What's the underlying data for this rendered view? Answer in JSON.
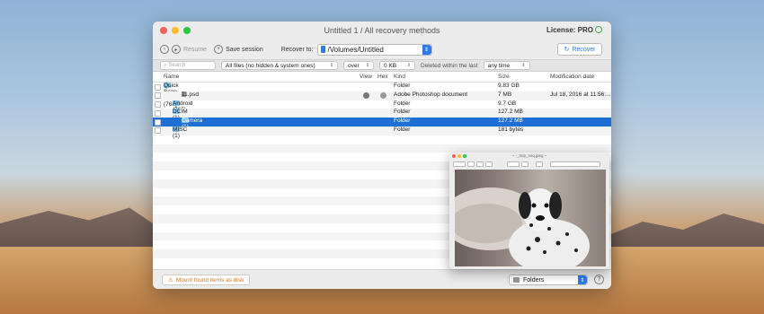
{
  "window": {
    "title": "Untitled 1 / All recovery methods",
    "license": "License: PRO"
  },
  "toolbar": {
    "resume": "Resume",
    "save_session": "Save session",
    "recover_to_label": "Recover to:",
    "path": "/Volumes/Untitled",
    "recover": "Recover"
  },
  "filter": {
    "search_placeholder": "Search",
    "file_filter": "All files (no hidden & system ones)",
    "size_op": "over",
    "size_value": "0 KB",
    "deleted_label": "Deleted within the last",
    "time_value": "any time"
  },
  "columns": {
    "name": "Name",
    "view": "View",
    "hex": "Hex",
    "kind": "Kind",
    "size": "Size",
    "modified": "Modification date"
  },
  "rows": [
    {
      "name": "Quick Scan - deleted (768)",
      "kind": "Folder",
      "size": "9.83 GB",
      "modified": ""
    },
    {
      "name": "11.psd",
      "kind": "Adobe Photoshop document",
      "size": "7 MB",
      "modified": "Jul 18, 2016 at 11:56:..."
    },
    {
      "name": "Android (765)",
      "kind": "Folder",
      "size": "9.7 GB",
      "modified": ""
    },
    {
      "name": "DCIM (1)",
      "kind": "Folder",
      "size": "127.2 MB",
      "modified": ""
    },
    {
      "name": "Camera (1)",
      "kind": "Folder",
      "size": "127.2 MB",
      "modified": ""
    },
    {
      "name": "MISC (1)",
      "kind": "Folder",
      "size": "181 bytes",
      "modified": ""
    }
  ],
  "bottom": {
    "mount": "Mount found items as disk",
    "view_mode": "Folders"
  },
  "preview": {
    "title": "~ -_tmp_nsq.jpeg ~"
  },
  "colors": {
    "accent": "#1f6fd6",
    "folder": "#7fc1e8",
    "warning": "#e0761b"
  }
}
